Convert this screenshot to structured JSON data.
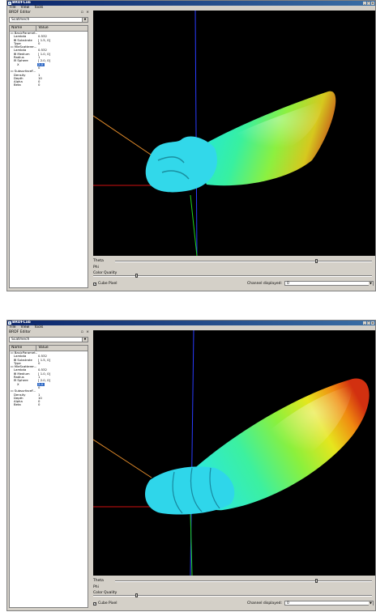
{
  "app": {
    "title": "BRDFLab"
  },
  "menu": [
    "File",
    "View",
    "Tools"
  ],
  "editor": {
    "title": "BRDF Editor",
    "ctrls": "▫ ×",
    "model_selected": "Scatmech",
    "columns": [
      "Name",
      "Value"
    ],
    "rows": [
      {
        "name": "▭ BasicParamet...",
        "value": "",
        "indent": 0
      },
      {
        "name": "Lambda",
        "value": "0.532",
        "indent": 2
      },
      {
        "name": "⊞ Substrate",
        "value": "[ 1.5, 0]",
        "indent": 2
      },
      {
        "name": "Type",
        "value": "0",
        "indent": 2
      },
      {
        "name": "▭ MieScatterer...",
        "value": "",
        "indent": 0
      },
      {
        "name": "Lambda",
        "value": "0.532",
        "indent": 2
      },
      {
        "name": "⊞ Medium",
        "value": "[ 1.0, 0]",
        "indent": 2
      },
      {
        "name": "Radius",
        "value": "1",
        "indent": 2
      },
      {
        "name": "⊟ Sphere",
        "value": "[ 2.0, 0]",
        "indent": 2
      },
      {
        "name": "X",
        "value": "2.0",
        "indent": 4,
        "hl": true
      },
      {
        "name": "",
        "value": "0",
        "indent": 4
      },
      {
        "name": "▭ SubsurfaceF...",
        "value": "",
        "indent": 0
      },
      {
        "name": "Density",
        "value": "1",
        "indent": 2
      },
      {
        "name": "Depth",
        "value": "10",
        "indent": 2
      },
      {
        "name": "Alpha",
        "value": "0",
        "indent": 2
      },
      {
        "name": "Beta",
        "value": "0",
        "indent": 2
      }
    ]
  },
  "controls": {
    "theta_label": "Theta",
    "phi_label": "Phi",
    "color_quality_label": "Color Quality",
    "cube_pixel_label": "Cube Pixel",
    "cube_pixel_checked": true,
    "channel_label": "Channel displayed:",
    "channel_value": "0",
    "theta_value": 0.78,
    "color_quality_value": 0.15
  },
  "windows": [
    {
      "id": "top",
      "lobe_variant": "short"
    },
    {
      "id": "bottom",
      "lobe_variant": "long"
    }
  ]
}
